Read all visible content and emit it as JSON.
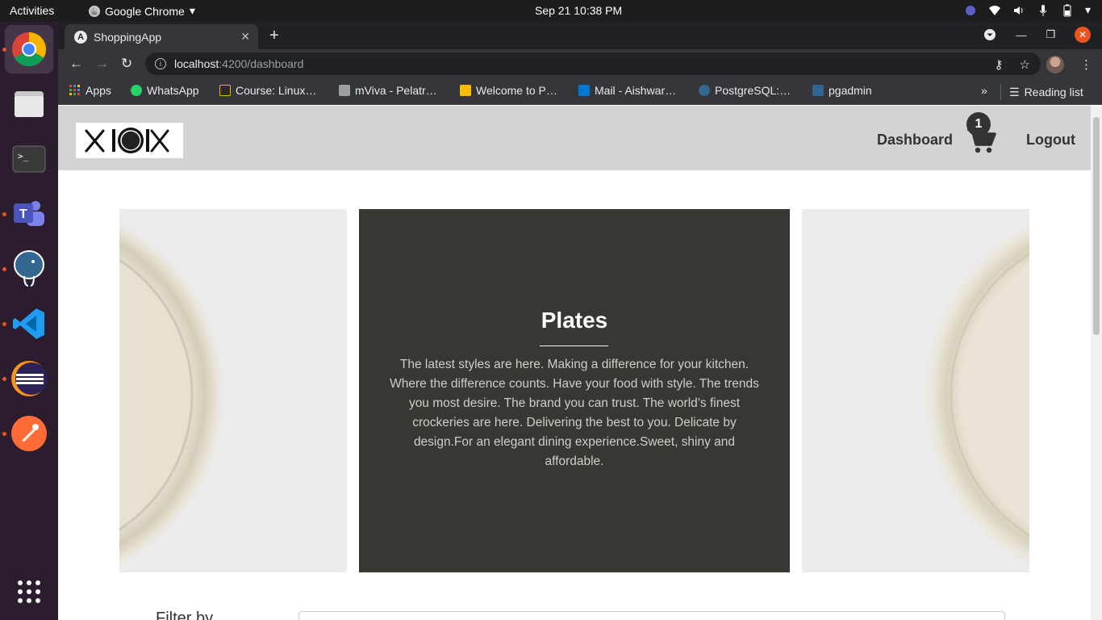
{
  "system_bar": {
    "activities": "Activities",
    "app_name": "Google Chrome",
    "clock": "Sep 21  10:38 PM"
  },
  "dock": {
    "apps": [
      {
        "name": "Google Chrome"
      },
      {
        "name": "Files"
      },
      {
        "name": "Terminal"
      },
      {
        "name": "Microsoft Teams"
      },
      {
        "name": "pgAdmin"
      },
      {
        "name": "Visual Studio Code"
      },
      {
        "name": "Eclipse"
      },
      {
        "name": "Postman"
      }
    ],
    "show_apps": "Show Applications"
  },
  "browser": {
    "tab_title": "ShoppingApp",
    "url_host": "localhost",
    "url_path": ":4200/dashboard",
    "bookmarks": [
      {
        "label": "Apps",
        "color": "#ea4335"
      },
      {
        "label": "WhatsApp",
        "color": "#25d366"
      },
      {
        "label": "Course: Linux…",
        "color": "#f4b400"
      },
      {
        "label": "mViva - Pelatr…",
        "color": "#9aa0a6"
      },
      {
        "label": "Welcome to P…",
        "color": "#fbbc04"
      },
      {
        "label": "Mail - Aishwar…",
        "color": "#0078d4"
      },
      {
        "label": "PostgreSQL:…",
        "color": "#336791"
      },
      {
        "label": "pgadmin",
        "color": "#326690"
      }
    ],
    "overflow": "»",
    "reading_list": "Reading list"
  },
  "app": {
    "nav": {
      "dashboard": "Dashboard",
      "logout": "Logout"
    },
    "cart_count": "1",
    "carousel": {
      "title": "Plates",
      "description": "The latest styles are here. Making a difference for your kitchen. Where the difference counts. Have your food with style. The trends you most desire. The brand you can trust. The world’s finest crockeries are here. Delivering the best to you. Delicate by design.For an elegant dining experience.Sweet, shiny and affordable."
    },
    "filter_label": "Filter by"
  },
  "colors": {
    "header_bg": "#d3d3d3",
    "slide_dark": "#383833",
    "accent_orange": "#e95420"
  }
}
